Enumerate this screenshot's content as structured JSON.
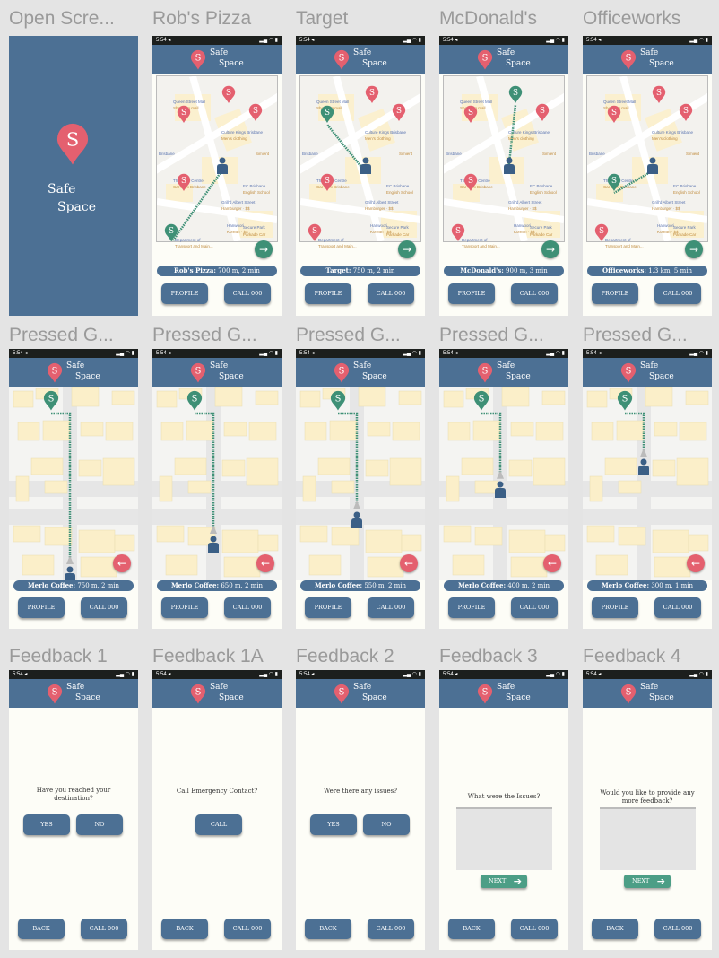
{
  "app": {
    "name_line1": "Safe",
    "name_line2": "Space",
    "logo_letter": "S",
    "status_time": "5:54 ◂"
  },
  "colors": {
    "header": "#4c7094",
    "pin_red": "#e4606f",
    "pin_green": "#3e9076",
    "background": "#fdfdf7",
    "canvas": "#e4e4e4"
  },
  "buttons": {
    "profile": "PROFILE",
    "call": "CALL 000",
    "back": "BACK",
    "yes": "YES",
    "no": "NO",
    "call_contact": "CALL",
    "next": "NEXT"
  },
  "map_labels": [
    "Queen Street Mall",
    "Shopping mall",
    "Culture Kings Brisbane",
    "Men's clothing",
    "Brisbane",
    "Simient",
    "EC Brisbane",
    "English School",
    "The Myer Centre",
    "Car Park Brisbane",
    "Grill'd Albert Street",
    "Hamburger · $$",
    "Hanwoori",
    "Korean · $$",
    "Secure Park",
    "Parkade Car",
    "Department of",
    "Transport and Main...",
    "The Great Southern",
    "Hotel Brisbane"
  ],
  "row1": [
    {
      "title": "Open Scre...",
      "type": "open"
    },
    {
      "title": "Rob's Pizza",
      "type": "select",
      "info_name": "Rob's Pizza:",
      "info_value": "700 m, 2 min",
      "target": 4
    },
    {
      "title": "Target",
      "type": "select",
      "info_name": "Target:",
      "info_value": "750 m, 2 min",
      "target": 1
    },
    {
      "title": "McDonald's",
      "type": "select",
      "info_name": "McDonald's:",
      "info_value": "900 m, 3 min",
      "target": 0
    },
    {
      "title": "Officeworks",
      "type": "select",
      "info_name": "Officeworks:",
      "info_value": "1.3 km, 5 min",
      "target": 3
    }
  ],
  "row2": [
    {
      "title": "Pressed G...",
      "info_name": "Merlo Coffee:",
      "info_value": "750 m, 2 min",
      "progress": 0
    },
    {
      "title": "Pressed G...",
      "info_name": "Merlo Coffee:",
      "info_value": "650 m, 2 min",
      "progress": 0.25
    },
    {
      "title": "Pressed G...",
      "info_name": "Merlo Coffee:",
      "info_value": "550 m, 2 min",
      "progress": 0.45
    },
    {
      "title": "Pressed G...",
      "info_name": "Merlo Coffee:",
      "info_value": "400 m, 2 min",
      "progress": 0.7
    },
    {
      "title": "Pressed G...",
      "info_name": "Merlo Coffee:",
      "info_value": "300 m, 1 min",
      "progress": 0.88
    }
  ],
  "row3": [
    {
      "title": "Feedback 1",
      "question": "Have you reached your destination?",
      "kind": "yesno"
    },
    {
      "title": "Feedback 1A",
      "question": "Call Emergency Contact?",
      "kind": "call"
    },
    {
      "title": "Feedback 2",
      "question": "Were there any issues?",
      "kind": "yesno"
    },
    {
      "title": "Feedback 3",
      "question": "What were the Issues?",
      "kind": "text"
    },
    {
      "title": "Feedback 4",
      "question": "Would you like to provide any more feedback?",
      "kind": "text"
    }
  ]
}
